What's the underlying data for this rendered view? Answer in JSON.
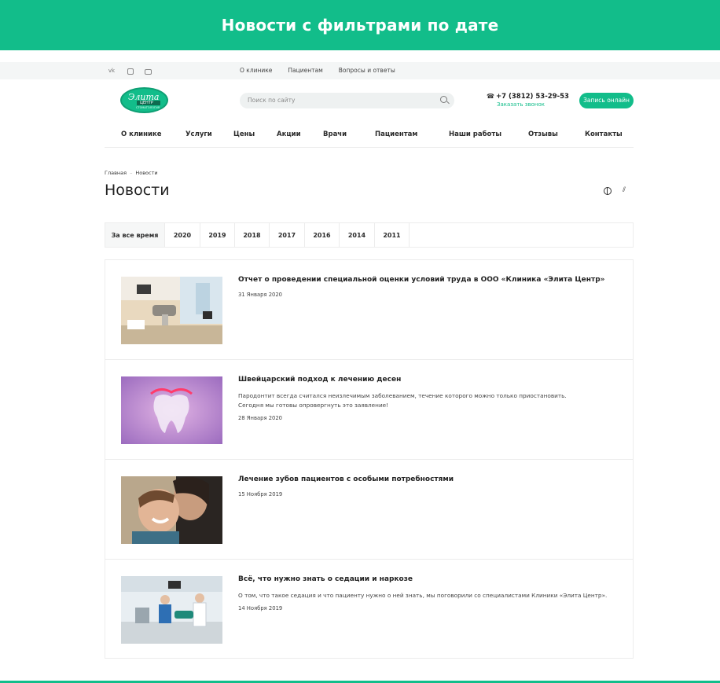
{
  "banner": {
    "title": "Новости с фильтрами по дате"
  },
  "topbar": {
    "social_icons": [
      "vk-icon",
      "instagram-icon",
      "youtube-icon"
    ],
    "vk_label": "vk",
    "links": [
      "О клинике",
      "Пациентам",
      "Вопросы и ответы"
    ]
  },
  "header": {
    "logo_script": "Элита",
    "logo_bar": "ЦЕНТР",
    "logo_sub": "СТОМАТОЛОГИЯ",
    "search_placeholder": "Поиск по сайту",
    "phone": "+7 (3812) 53-29-53",
    "callback": "Заказать звонок",
    "cta": "Запись онлайн"
  },
  "nav": [
    "О клинике",
    "Услуги",
    "Цены",
    "Акции",
    "Врачи",
    "Пациентам",
    "Наши работы",
    "Отзывы",
    "Контакты"
  ],
  "breadcrumb": {
    "home": "Главная",
    "current": "Новости"
  },
  "page_title": "Новости",
  "filters": [
    "За все время",
    "2020",
    "2019",
    "2018",
    "2017",
    "2016",
    "2014",
    "2011"
  ],
  "active_filter": "За все время",
  "news": [
    {
      "title": "Отчет о проведении специальной оценки условий труда в ООО «Клиника «Элита Центр»",
      "desc1": "",
      "desc2": "",
      "date": "31 Января 2020",
      "image": "dental-office-photo"
    },
    {
      "title": "Швейцарский подход к лечению десен",
      "desc1": "Пародонтит всегда считался неизлечимым заболеванием, течение которого можно только приостановить.",
      "desc2": "Сегодня мы готовы опровергнуть это заявление!",
      "date": "28 Января 2020",
      "image": "tooth-illustration"
    },
    {
      "title": "Лечение зубов пациентов с особыми потребностями",
      "desc1": "",
      "desc2": "",
      "date": "15 Ноября 2019",
      "image": "mother-child-photo"
    },
    {
      "title": "Всё, что нужно знать о седации и наркозе",
      "desc1": "О том, что такое седация и что пациенту нужно о ней знать, мы поговорили со специалистами Клиники «Элита Центр».",
      "desc2": "",
      "date": "14 Ноября 2019",
      "image": "surgery-team-photo"
    }
  ],
  "colors": {
    "brand": "#12bd8a",
    "text": "#2b2b2b",
    "border": "#ececec"
  }
}
